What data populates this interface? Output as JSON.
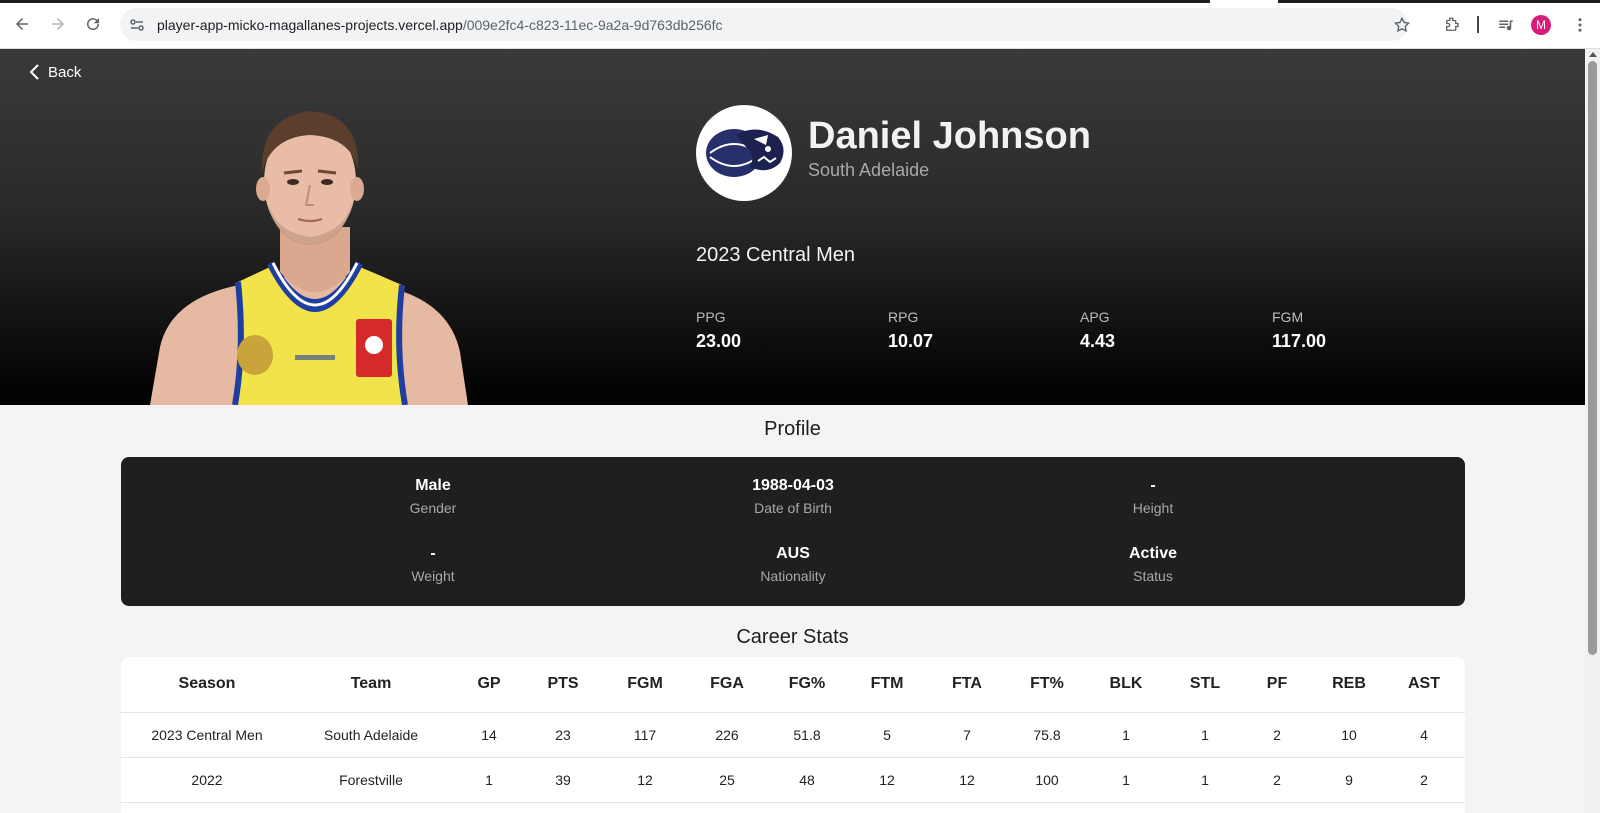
{
  "browser": {
    "url_host": "player-app-micko-magallanes-projects.vercel.app",
    "url_path": "/009e2fc4-c823-11ec-9a2a-9d763db256fc",
    "avatar_letter": "M"
  },
  "hero": {
    "back_label": "Back",
    "player_name": "Daniel Johnson",
    "team_name": "South Adelaide",
    "season_title": "2023 Central Men",
    "stats": [
      {
        "label": "PPG",
        "value": "23.00"
      },
      {
        "label": "RPG",
        "value": "10.07"
      },
      {
        "label": "APG",
        "value": "4.43"
      },
      {
        "label": "FGM",
        "value": "117.00"
      }
    ]
  },
  "profile": {
    "title": "Profile",
    "items": [
      {
        "value": "Male",
        "label": "Gender"
      },
      {
        "value": "1988-04-03",
        "label": "Date of Birth"
      },
      {
        "value": "-",
        "label": "Height"
      },
      {
        "value": "-",
        "label": "Weight"
      },
      {
        "value": "AUS",
        "label": "Nationality"
      },
      {
        "value": "Active",
        "label": "Status"
      }
    ]
  },
  "career": {
    "title": "Career Stats",
    "headers": [
      "Season",
      "Team",
      "GP",
      "PTS",
      "FGM",
      "FGA",
      "FG%",
      "FTM",
      "FTA",
      "FT%",
      "BLK",
      "STL",
      "PF",
      "REB",
      "AST"
    ],
    "rows": [
      [
        "2023 Central Men",
        "South Adelaide",
        "14",
        "23",
        "117",
        "226",
        "51.8",
        "5",
        "7",
        "75.8",
        "1",
        "1",
        "2",
        "10",
        "4"
      ],
      [
        "2022",
        "Forestville",
        "1",
        "39",
        "12",
        "25",
        "48",
        "12",
        "12",
        "100",
        "1",
        "1",
        "2",
        "9",
        "2"
      ]
    ]
  },
  "colors": {
    "hero_top": "#3a3a3a",
    "hero_bottom": "#000000",
    "card_dark": "#1f1f1f",
    "page_bg": "#f5f4f2",
    "jersey_yellow": "#f3e34a",
    "jersey_blue": "#1f3fa0"
  }
}
